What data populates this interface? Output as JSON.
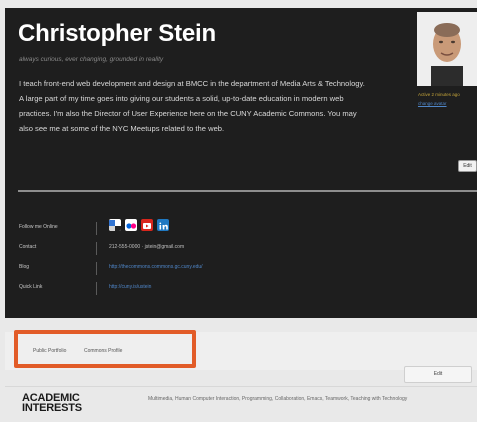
{
  "profile": {
    "name": "Christopher Stein",
    "tagline": "always curious, ever changing, grounded in reality",
    "bio": "I teach front-end web development and design at BMCC in the department of Media Arts & Technology. A large part of my time goes into giving our students a solid, up-to-date education in modern web practices. I'm also the Director of User Experience here on the CUNY Academic Commons. You may also see me at some of the NYC Meetups related to the web.",
    "avatar_caption": "Active 2 minutes ago",
    "avatar_link": "change avatar",
    "edit_label": "Edit"
  },
  "info": {
    "rows": [
      {
        "label": "Follow me Online",
        "value": ""
      },
      {
        "label": "Contact",
        "value": "212-555-0000 · jstein@gmail.com"
      },
      {
        "label": "Blog",
        "value": "http://thecommons.commons.gc.cuny.edu/"
      },
      {
        "label": "Quick Link",
        "value": "http://cuny.is/ustein"
      }
    ],
    "social_icons": [
      "delicious-icon",
      "flickr-icon",
      "youtube-icon",
      "linkedin-icon"
    ]
  },
  "tabs": {
    "items": [
      {
        "label": "Public Portfolio"
      },
      {
        "label": "Commons Profile"
      }
    ],
    "highlight_color": "#e25c28"
  },
  "actions": {
    "button_label": "Edit"
  },
  "interests": {
    "heading": "ACADEMIC INTERESTS",
    "body": "Multimedia, Human Computer Interaction, Programming, Collaboration, Emacs, Teamwork, Teaching with Technology"
  },
  "colors": {
    "header_bg": "#1e1e1e",
    "link": "#4f86c8",
    "accent": "#e25c28"
  }
}
